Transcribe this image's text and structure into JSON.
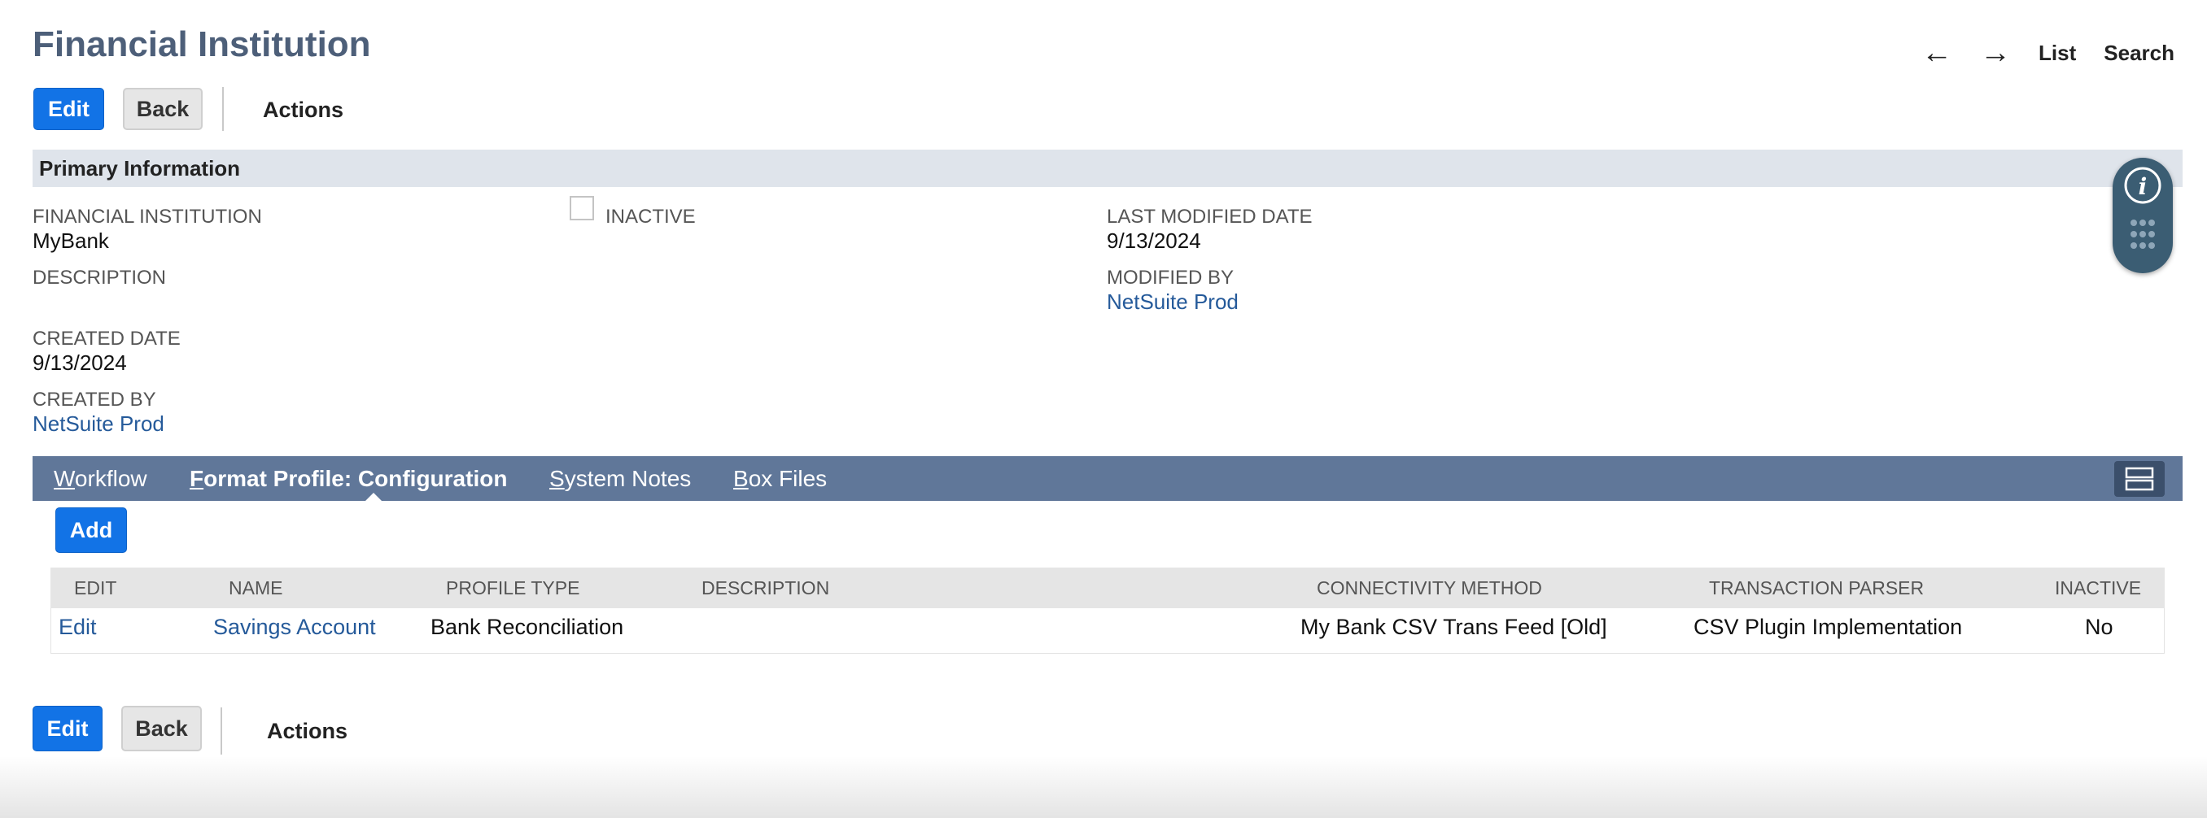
{
  "header": {
    "title": "Financial Institution",
    "nav_links": {
      "list": "List",
      "search": "Search"
    }
  },
  "toolbar": {
    "edit_label": "Edit",
    "back_label": "Back",
    "actions_label": "Actions"
  },
  "primary_info": {
    "section_title": "Primary Information",
    "financial_institution_label": "FINANCIAL INSTITUTION",
    "financial_institution_value": "MyBank",
    "inactive_label": "INACTIVE",
    "inactive_checked": false,
    "description_label": "DESCRIPTION",
    "created_date_label": "CREATED DATE",
    "created_date_value": "9/13/2024",
    "created_by_label": "CREATED BY",
    "created_by_value": "NetSuite Prod",
    "last_modified_label": "LAST MODIFIED DATE",
    "last_modified_value": "9/13/2024",
    "modified_by_label": "MODIFIED BY",
    "modified_by_value": "NetSuite Prod"
  },
  "tabs": [
    {
      "first": "W",
      "rest": "orkflow",
      "active": false
    },
    {
      "first": "F",
      "rest": "ormat Profile: Configuration",
      "active": true
    },
    {
      "first": "S",
      "rest": "ystem Notes",
      "active": false
    },
    {
      "first": "B",
      "rest": "ox Files",
      "active": false
    }
  ],
  "sublist": {
    "add_label": "Add",
    "columns": [
      "EDIT",
      "NAME",
      "PROFILE TYPE",
      "DESCRIPTION",
      "CONNECTIVITY METHOD",
      "TRANSACTION PARSER",
      "INACTIVE"
    ],
    "rows": [
      {
        "edit": "Edit",
        "name": "Savings Account",
        "profile_type": "Bank Reconciliation",
        "description": "",
        "connectivity_method": "My Bank CSV Trans Feed [Old]",
        "transaction_parser": "CSV Plugin Implementation",
        "inactive": "No"
      }
    ]
  },
  "footer_toolbar": {
    "edit_label": "Edit",
    "back_label": "Back",
    "actions_label": "Actions"
  },
  "colors": {
    "title": "#4d5f79",
    "primary_button": "#1273e6",
    "tab_bar": "#607799",
    "section_bar": "#dfe4eb",
    "link": "#255a9a",
    "info_widget": "#3b5d73"
  },
  "icons": {
    "back_arrow": "arrow-left-icon",
    "forward_arrow": "arrow-right-icon",
    "info": "info-icon",
    "menu_grid": "grid-dots-icon",
    "layout_toggle": "layout-toggle-icon"
  }
}
